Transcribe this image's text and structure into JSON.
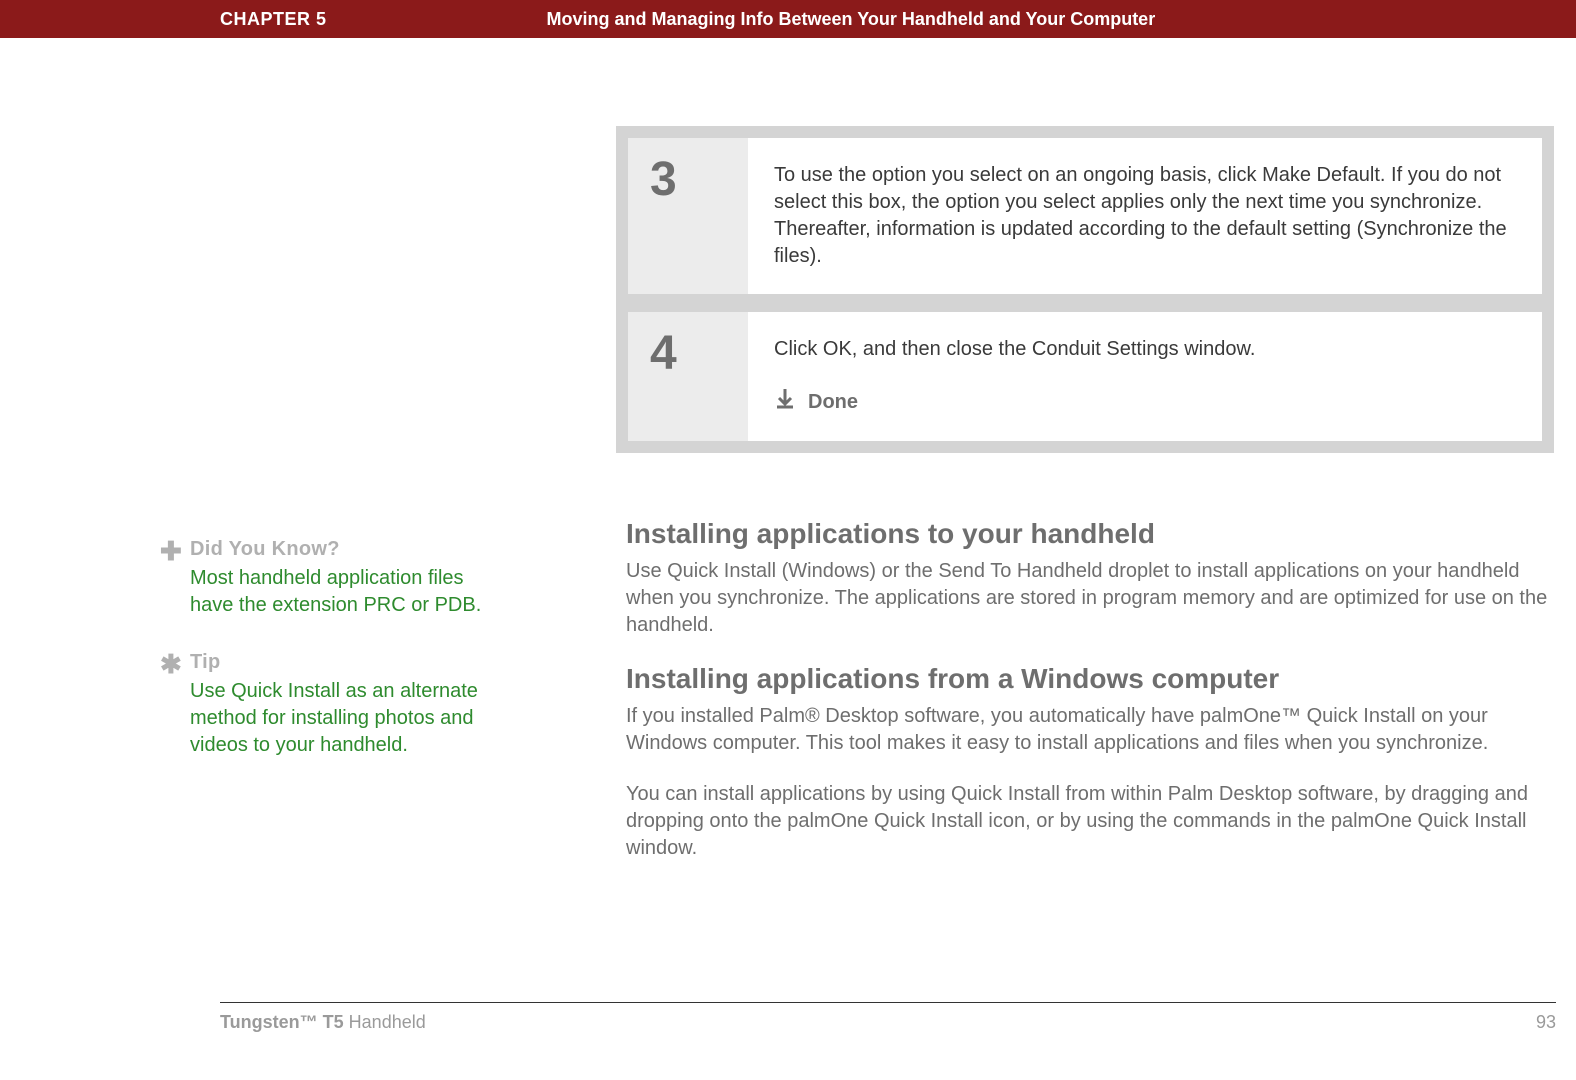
{
  "header": {
    "chapter": "CHAPTER 5",
    "title": "Moving and Managing Info Between Your Handheld and Your Computer"
  },
  "sidebar": {
    "blocks": [
      {
        "icon": "✚",
        "heading": "Did You Know?",
        "body": "Most handheld application files have the extension PRC or PDB."
      },
      {
        "icon": "✱",
        "heading": "Tip",
        "body": "Use Quick Install as an alternate method for installing photos and videos to your handheld."
      }
    ]
  },
  "steps": [
    {
      "num": "3",
      "body": "To use the option you select on an ongoing basis, click Make Default. If you do not select this box, the option you select applies only the next time you synchronize. Thereafter, information is updated according to the default setting (Synchronize the files)."
    },
    {
      "num": "4",
      "body": "Click OK, and then close the Conduit Settings window.",
      "done_label": "Done"
    }
  ],
  "article": {
    "sections": [
      {
        "heading": "Installing applications to your handheld",
        "paras": [
          "Use Quick Install (Windows) or the Send To Handheld droplet to install applications on your handheld when you synchronize. The applications are stored in program memory and are optimized for use on the handheld."
        ]
      },
      {
        "heading": "Installing applications from a Windows computer",
        "paras": [
          "If you installed Palm® Desktop software, you automatically have palmOne™ Quick Install on your Windows computer. This tool makes it easy to install applications and files when you synchronize.",
          "You can install applications by using Quick Install from within Palm Desktop software, by dragging and dropping onto the palmOne Quick Install icon, or by using the commands in the palmOne Quick Install window."
        ]
      }
    ]
  },
  "footer": {
    "product_bold": "Tungsten™ T5",
    "product_rest": " Handheld",
    "page_number": "93"
  }
}
